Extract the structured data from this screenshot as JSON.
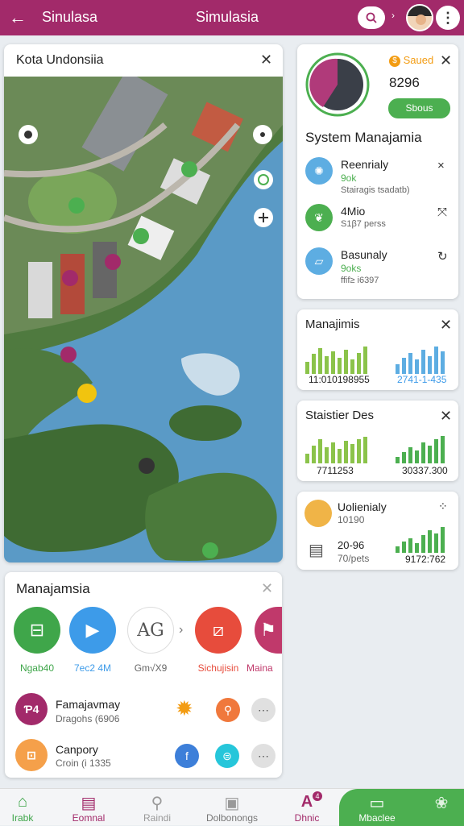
{
  "header": {
    "back_icon": "arrow-left-icon",
    "title_left": "Sinulasa",
    "title_center": "Simulasia",
    "search_icon": "search-icon",
    "menu_icon": "more-vertical-icon",
    "color": "#a22a6a"
  },
  "map_card": {
    "title": "Kota Undonsiia"
  },
  "stats_card": {
    "badge": "Saued",
    "badge_icon": "coin-icon",
    "amount": "8296",
    "button": "Sbous",
    "system_title": "System Manajamia",
    "items": [
      {
        "name": "Reenrialy",
        "value": "9ok",
        "sub": "Stairagis tsadatb)",
        "icon": "gear-icon",
        "action": "×"
      },
      {
        "name": "4Mio",
        "value": "",
        "sub": "S1β7 perss",
        "icon": "leaf-icon",
        "action": "⤧"
      },
      {
        "name": "Basunaly",
        "value": "9oks",
        "sub": "ffif≥ i6397",
        "icon": "chart-icon",
        "action": "↻"
      }
    ]
  },
  "card_managements": {
    "title": "Manajimis",
    "left_value": "11:010198955",
    "right_value": "2741-1-435"
  },
  "card_statistics": {
    "title": "Staistier Des",
    "left_value": "7711253",
    "right_value": "30337.300"
  },
  "card_profile": {
    "name": "Uolienialy",
    "value1": "10190",
    "row2_a": "20-96",
    "row2_b": "70/pets",
    "right_value": "9172:762"
  },
  "manage_card": {
    "title": "Manajamsia",
    "circles": [
      {
        "label": "Ngab40",
        "icon": "bag-icon",
        "color": "#3fa64a"
      },
      {
        "label": "7ec2 4M",
        "icon": "play-icon",
        "color": "#3d9be9"
      },
      {
        "label": "Gm√X9",
        "icon": "ag-icon",
        "color": "#ffffff",
        "text": "AG"
      },
      {
        "label": "Sichujisin",
        "icon": "screen-icon",
        "color": "#e74c3c"
      },
      {
        "label": "Maina",
        "icon": "flag-icon",
        "color": "#c0396b"
      }
    ],
    "rows": [
      {
        "name": "Famajavmay",
        "sub": "Dragohs (6906",
        "badge": "Ƥ4",
        "icon": "user-badge-icon"
      },
      {
        "name": "Canpory",
        "sub": "Croin (i 1335",
        "badge": "",
        "icon": "briefcase-icon"
      }
    ]
  },
  "bottom_nav": [
    {
      "label": "Irabk",
      "icon": "home-icon",
      "color": "#3fa64a"
    },
    {
      "label": "Eomnal",
      "icon": "calendar-icon",
      "color": "#a22a6a"
    },
    {
      "label": "Raindi",
      "icon": "search-icon",
      "color": "#999999"
    },
    {
      "label": "Dolbonongs",
      "icon": "document-icon",
      "color": "#999999"
    },
    {
      "label": "Dhnic",
      "icon": "font-icon",
      "color": "#a22a6a",
      "badge": "4"
    },
    {
      "label": "Mbaclee",
      "icon": "tv-icon",
      "color": "#ffffff"
    },
    {
      "label": "",
      "icon": "flower-icon",
      "color": "#ffffff"
    }
  ]
}
